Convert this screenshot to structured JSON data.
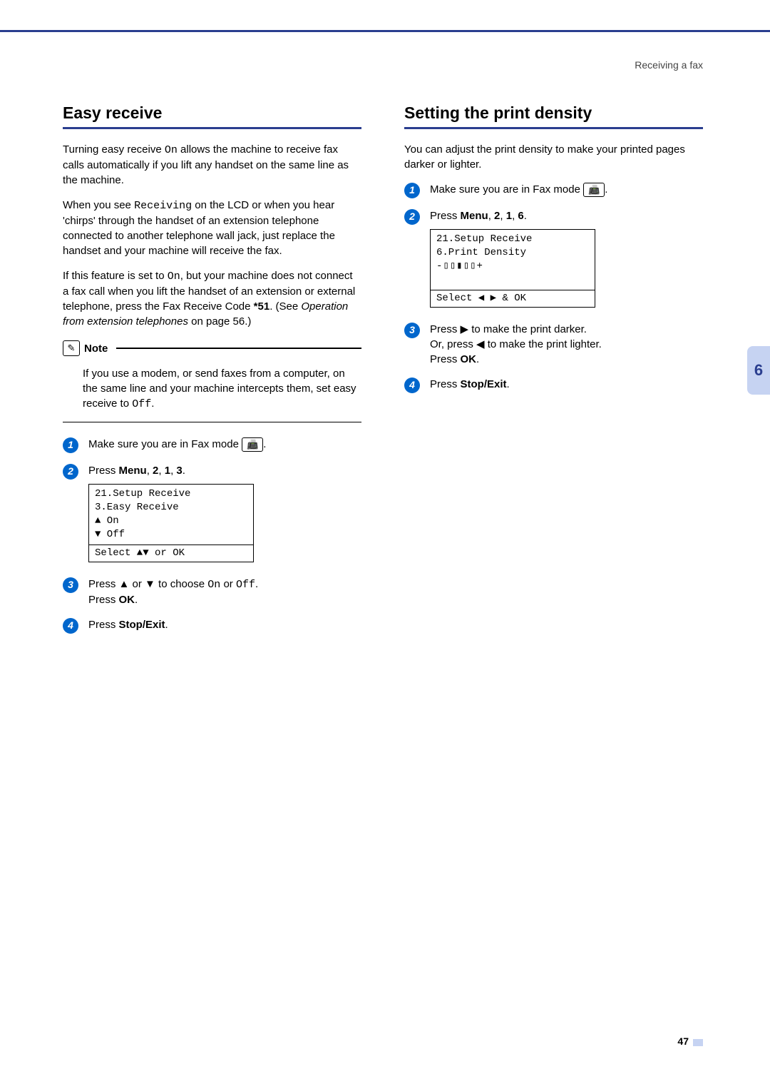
{
  "header": {
    "section": "Receiving a fax"
  },
  "left": {
    "title": "Easy receive",
    "p1a": "Turning easy receive ",
    "p1_on": "On",
    "p1b": " allows the machine to receive fax calls automatically if you lift any handset on the same line as the machine.",
    "p2a": "When you see ",
    "p2_recv": "Receiving",
    "p2b": " on the LCD or when you hear 'chirps' through the handset of an extension telephone connected to another telephone wall jack, just replace the handset and your machine will receive the fax.",
    "p3a": "If this feature is set to ",
    "p3_on": "On",
    "p3b": ", but your machine does not connect a fax call when you lift the handset of an extension or external telephone, press the Fax Receive Code ",
    "p3_code": "*51",
    "p3c": ". (See ",
    "p3_link": "Operation from extension telephones",
    "p3d": " on page 56.)",
    "note_label": "Note",
    "note_a": "If you use a modem, or send faxes from a computer, on the same line and your machine intercepts them, set easy receive to ",
    "note_off": "Off",
    "note_b": ".",
    "step1": "Make sure you are in Fax mode ",
    "step1_end": ".",
    "step2a": "Press ",
    "step2_menu": "Menu",
    "step2b": ", ",
    "step2_k1": "2",
    "step2c": ", ",
    "step2_k2": "1",
    "step2d": ", ",
    "step2_k3": "3",
    "step2e": ".",
    "lcd1_l1": "21.Setup Receive",
    "lcd1_l2": "  3.Easy Receive",
    "lcd1_l3": "▲    On",
    "lcd1_l4": "▼    Off",
    "lcd1_l5": "Select ▲▼ or OK",
    "step3a": "Press ▲ or ▼ to choose ",
    "step3_on": "On",
    "step3b": " or ",
    "step3_off": "Off",
    "step3c": ".",
    "step3d": "Press ",
    "step3_ok": "OK",
    "step3e": ".",
    "step4a": "Press ",
    "step4_se": "Stop/Exit",
    "step4b": "."
  },
  "right": {
    "title": "Setting the print density",
    "p1": "You can adjust the print density to make your printed pages darker or lighter.",
    "step1": "Make sure you are in Fax mode ",
    "step1_end": ".",
    "step2a": "Press ",
    "step2_menu": "Menu",
    "step2b": ", ",
    "step2_k1": "2",
    "step2c": ", ",
    "step2_k2": "1",
    "step2d": ", ",
    "step2_k3": "6",
    "step2e": ".",
    "lcd2_l1": "21.Setup Receive",
    "lcd2_l2": "  6.Print Density",
    "lcd2_l3": "      -▯▯▮▯▯+",
    "lcd2_l4": "Select ◀ ▶ & OK",
    "step3a": "Press ▶ to make the print darker.",
    "step3b": "Or, press ◀ to make the print lighter.",
    "step3c": "Press ",
    "step3_ok": "OK",
    "step3d": ".",
    "step4a": "Press ",
    "step4_se": "Stop/Exit",
    "step4b": "."
  },
  "tab": "6",
  "pagenum": "47",
  "fax_icon_glyph": "📠"
}
